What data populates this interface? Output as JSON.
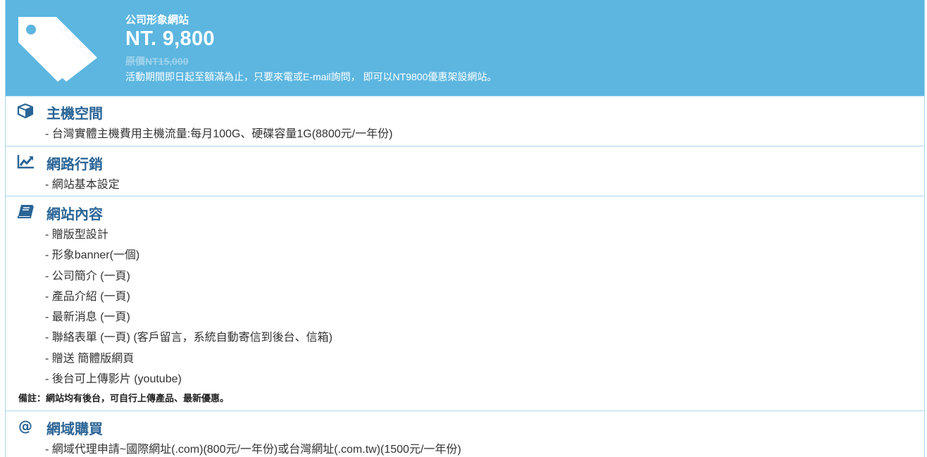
{
  "header": {
    "title": "公司形象網站",
    "price": "NT. 9,800",
    "original_price": "原價NT15,000",
    "promo": "活動期間即日起至額滿為止，只要來電或E-mail詢問， 即可以NT9800優惠架設網站。",
    "icon": "tags-icon",
    "bg_color": "#5cb6e0"
  },
  "sections": [
    {
      "icon": "cube-icon",
      "title": "主機空間",
      "items": [
        "- 台灣實體主機費用主機流量:每月100G、硬碟容量1G(8800元/一年份)"
      ]
    },
    {
      "icon": "chart-line-icon",
      "title": "網路行銷",
      "items": [
        "- 網站基本設定"
      ]
    },
    {
      "icon": "book-icon",
      "title": "網站內容",
      "items": [
        "- 贈版型設計",
        "- 形象banner(一個)",
        "- 公司簡介 (一頁)",
        "- 產品介紹 (一頁)",
        "- 最新消息 (一頁)",
        "- 聯絡表單 (一頁) (客戶留言，系統自動寄信到後台、信箱)",
        "- 贈送 簡體版網頁",
        "- 後台可上傳影片 (youtube)"
      ],
      "note": "備註：網站均有後台，可自行上傳產品、最新優惠。"
    },
    {
      "icon": "at-icon",
      "title": "網域購買",
      "items": [
        "- 網域代理申請~國際網址(.com)(800元/一年份)或台灣網址(.com.tw)(1500元/一年份)"
      ]
    }
  ]
}
